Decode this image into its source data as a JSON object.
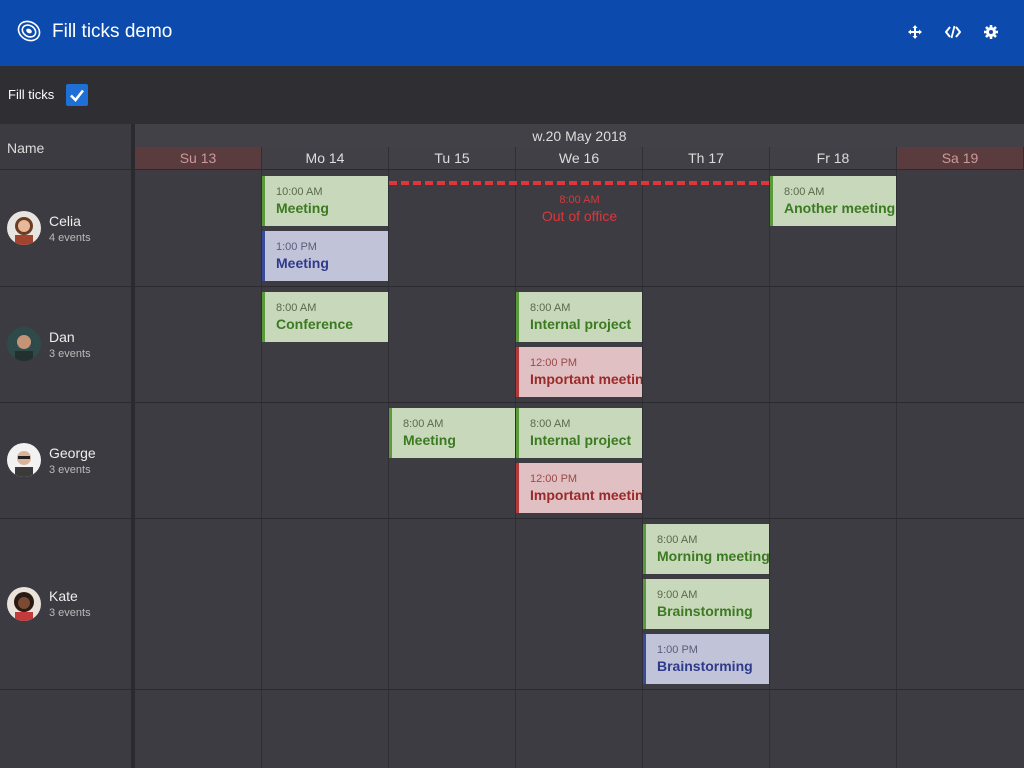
{
  "header": {
    "title": "Fill ticks demo",
    "icons": [
      "move-icon",
      "code-icon",
      "settings-icon"
    ]
  },
  "toolbar": {
    "fill_ticks_label": "Fill ticks",
    "fill_ticks_checked": true
  },
  "scheduler": {
    "name_header": "Name",
    "week_label": "w.20 May 2018",
    "days": [
      "Su 13",
      "Mo 14",
      "Tu 15",
      "We 16",
      "Th 17",
      "Fr 18",
      "Sa 19"
    ],
    "resources": [
      {
        "name": "Celia",
        "count": "4 events"
      },
      {
        "name": "Dan",
        "count": "3 events"
      },
      {
        "name": "George",
        "count": "3 events"
      },
      {
        "name": "Kate",
        "count": "3 events"
      }
    ],
    "events": [
      {
        "time": "10:00 AM",
        "name": "Meeting"
      },
      {
        "time": "1:00 PM",
        "name": "Meeting"
      },
      {
        "time": "8:00 AM",
        "name": "Another meeting"
      },
      {
        "time": "8:00 AM",
        "name": "Conference"
      },
      {
        "time": "8:00 AM",
        "name": "Internal project"
      },
      {
        "time": "12:00 PM",
        "name": "Important meetin"
      },
      {
        "time": "8:00 AM",
        "name": "Meeting"
      },
      {
        "time": "8:00 AM",
        "name": "Internal project"
      },
      {
        "time": "12:00 PM",
        "name": "Important meetin"
      },
      {
        "time": "8:00 AM",
        "name": "Morning meeting"
      },
      {
        "time": "9:00 AM",
        "name": "Brainstorming"
      },
      {
        "time": "1:00 PM",
        "name": "Brainstorming"
      }
    ],
    "out_of_office": {
      "time": "8:00 AM",
      "name": "Out of office"
    }
  },
  "colors": {
    "header": "#0c4bad",
    "accent_checkbox": "#1e6fd6",
    "event_green": "#c8d8bb",
    "event_blue": "#c1c3d9",
    "event_red": "#e0c0c2",
    "out_of_office": "#e0353a"
  }
}
